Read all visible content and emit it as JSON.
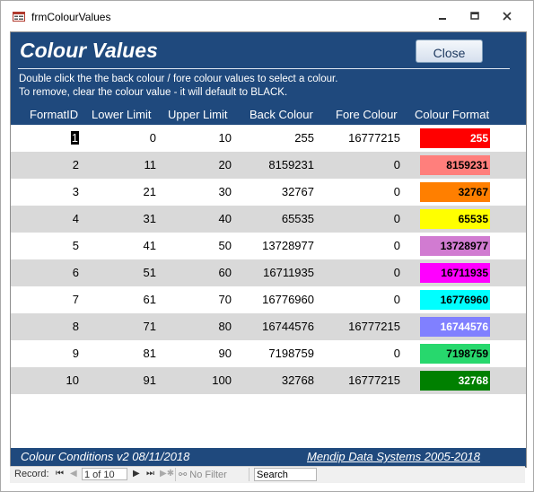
{
  "window": {
    "title": "frmColourValues"
  },
  "header": {
    "title": "Colour Values",
    "close_label": "Close",
    "instruction_1": "Double click the the back colour / fore colour values to select a colour.",
    "instruction_2": "To remove, clear the colour value - it will default to BLACK."
  },
  "columns": [
    "FormatID",
    "Lower Limit",
    "Upper Limit",
    "Back Colour",
    "Fore Colour",
    "Colour Format"
  ],
  "rows": [
    {
      "id": "1",
      "lower": "0",
      "upper": "10",
      "back": "255",
      "fore": "16777215",
      "format": "255",
      "bg": "#ff0000",
      "fg": "#ffffff"
    },
    {
      "id": "2",
      "lower": "11",
      "upper": "20",
      "back": "8159231",
      "fore": "0",
      "format": "8159231",
      "bg": "#ff7f7c",
      "fg": "#000000"
    },
    {
      "id": "3",
      "lower": "21",
      "upper": "30",
      "back": "32767",
      "fore": "0",
      "format": "32767",
      "bg": "#ff7f00",
      "fg": "#000000"
    },
    {
      "id": "4",
      "lower": "31",
      "upper": "40",
      "back": "65535",
      "fore": "0",
      "format": "65535",
      "bg": "#ffff00",
      "fg": "#000000"
    },
    {
      "id": "5",
      "lower": "41",
      "upper": "50",
      "back": "13728977",
      "fore": "0",
      "format": "13728977",
      "bg": "#d17bd1",
      "fg": "#000000"
    },
    {
      "id": "6",
      "lower": "51",
      "upper": "60",
      "back": "16711935",
      "fore": "0",
      "format": "16711935",
      "bg": "#ff00ff",
      "fg": "#000000"
    },
    {
      "id": "7",
      "lower": "61",
      "upper": "70",
      "back": "16776960",
      "fore": "0",
      "format": "16776960",
      "bg": "#00ffff",
      "fg": "#000000"
    },
    {
      "id": "8",
      "lower": "71",
      "upper": "80",
      "back": "16744576",
      "fore": "16777215",
      "format": "16744576",
      "bg": "#8080ff",
      "fg": "#ffffff"
    },
    {
      "id": "9",
      "lower": "81",
      "upper": "90",
      "back": "7198759",
      "fore": "0",
      "format": "7198759",
      "bg": "#27d86d",
      "fg": "#000000"
    },
    {
      "id": "10",
      "lower": "91",
      "upper": "100",
      "back": "32768",
      "fore": "16777215",
      "format": "32768",
      "bg": "#008000",
      "fg": "#ffffff"
    }
  ],
  "footer": {
    "left": "Colour Conditions   v2  08/11/2018",
    "right": "Mendip Data Systems 2005-2018"
  },
  "navigator": {
    "record_label": "Record:",
    "record_value": "1 of 10",
    "no_filter": "No Filter",
    "search_placeholder": "Search"
  },
  "colors": {
    "header_bg": "#1f497d",
    "alt_row": "#d9d9d9"
  }
}
